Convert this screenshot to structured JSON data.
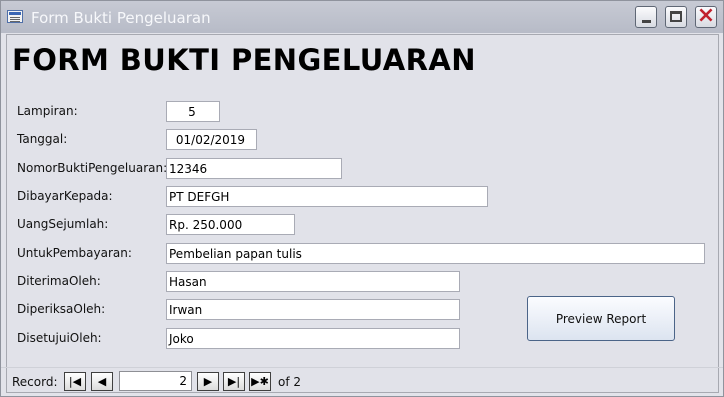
{
  "window": {
    "title": "Form Bukti Pengeluaran"
  },
  "form": {
    "heading": "FORM BUKTI PENGELUARAN",
    "fields": [
      {
        "label": "Lampiran:",
        "value": "5"
      },
      {
        "label": "Tanggal:",
        "value": "01/02/2019"
      },
      {
        "label": "NomorBuktiPengeluaran:",
        "value": "12346"
      },
      {
        "label": "DibayarKepada:",
        "value": "PT DEFGH"
      },
      {
        "label": "UangSejumlah:",
        "value": "Rp. 250.000"
      },
      {
        "label": "UntukPembayaran:",
        "value": "Pembelian papan tulis"
      },
      {
        "label": "DiterimaOleh:",
        "value": "Hasan"
      },
      {
        "label": "DiperiksaOleh:",
        "value": "Irwan"
      },
      {
        "label": "DisetujuiOleh:",
        "value": "Joko"
      }
    ],
    "preview_button": "Preview Report"
  },
  "navigation": {
    "record_label": "Record:",
    "current": "2",
    "of_label": "of 2",
    "buttons": [
      "first-record",
      "previous-record",
      "next-record",
      "last-record",
      "new-record"
    ]
  },
  "icons": {
    "close": "close-icon",
    "minimize": "minimize-icon",
    "maximize": "maximize-icon"
  }
}
